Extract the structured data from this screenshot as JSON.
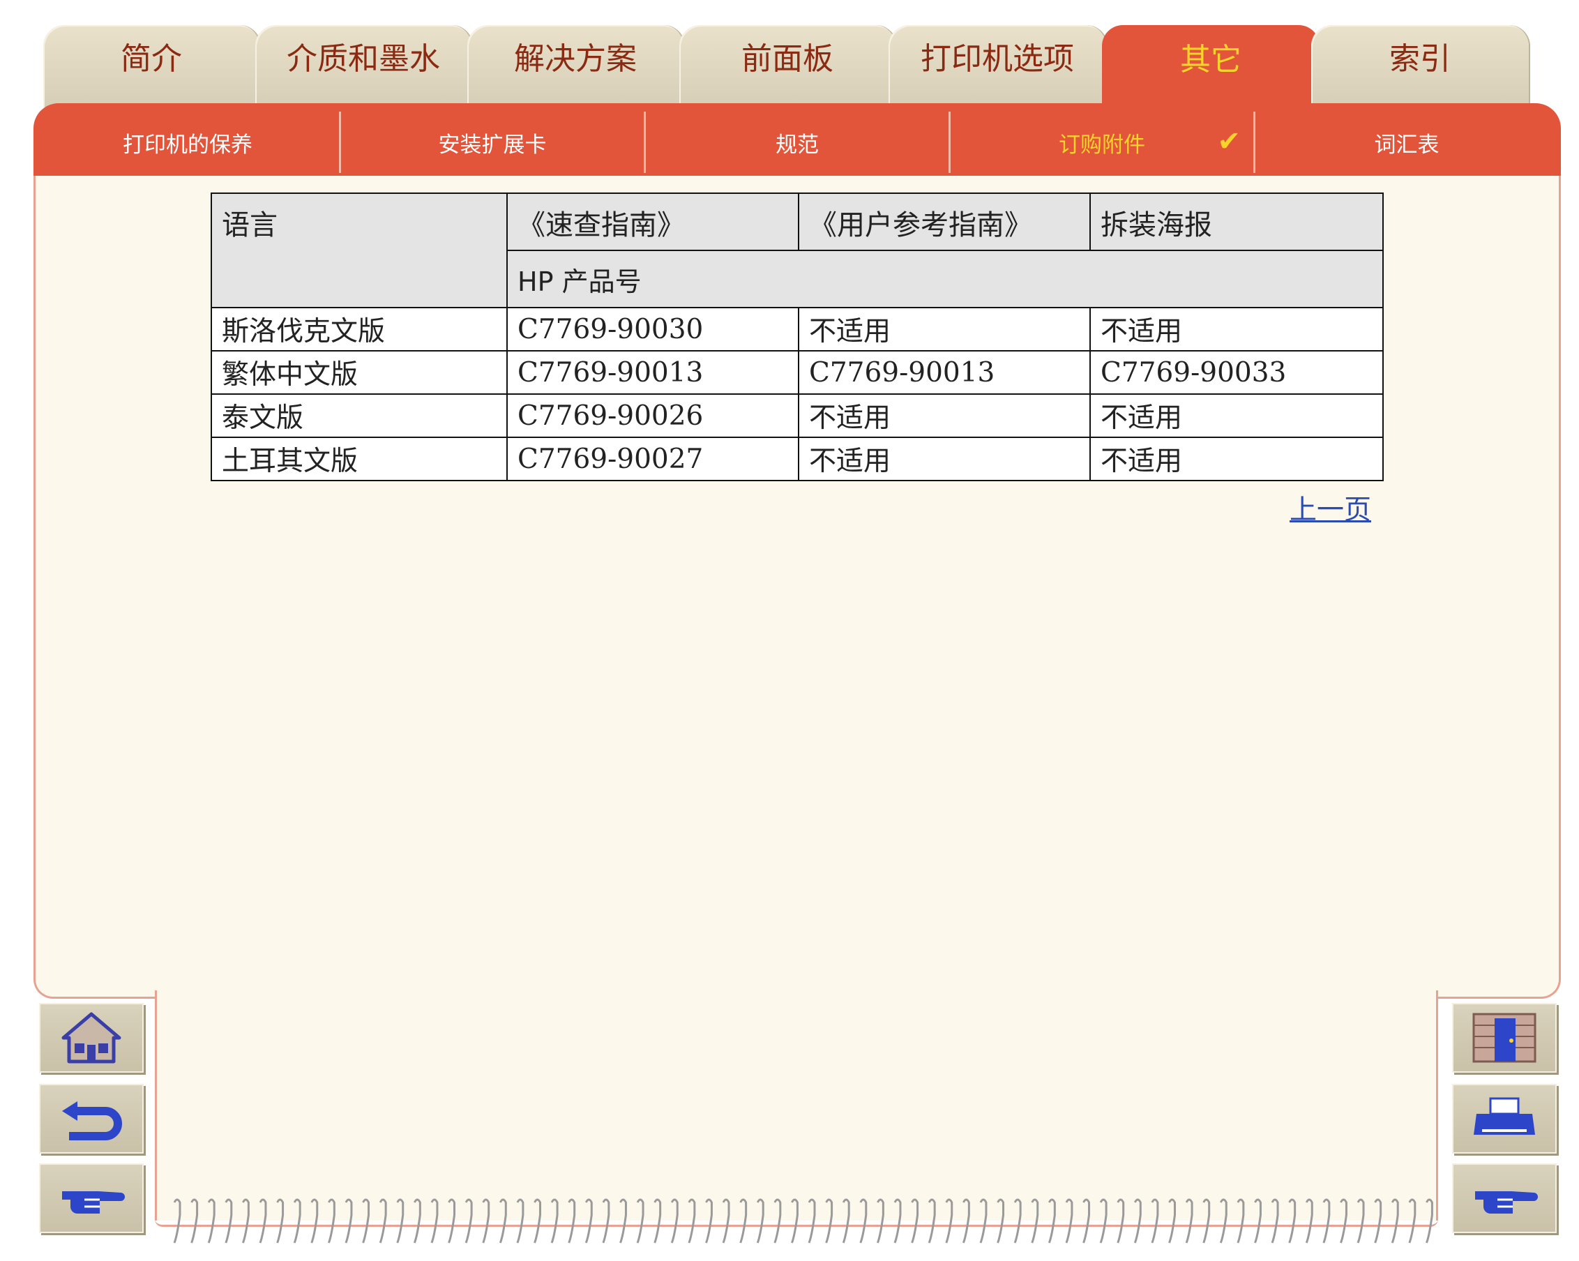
{
  "tabs": [
    {
      "label": "简介"
    },
    {
      "label": "介质和墨水"
    },
    {
      "label": "解决方案"
    },
    {
      "label": "前面板"
    },
    {
      "label": "打印机选项"
    },
    {
      "label": "其它"
    },
    {
      "label": "索引"
    }
  ],
  "subnav": [
    {
      "label": "打印机的保养"
    },
    {
      "label": "安装扩展卡"
    },
    {
      "label": "规范"
    },
    {
      "label": "订购附件",
      "check": "✔"
    },
    {
      "label": "词汇表"
    }
  ],
  "table": {
    "headers": [
      "语言",
      "《速查指南》",
      "《用户参考指南》",
      "拆装海报"
    ],
    "subheader": "HP 产品号",
    "rows": [
      [
        "斯洛伐克文版",
        "C7769-90030",
        "不适用",
        "不适用"
      ],
      [
        "繁体中文版",
        "C7769-90013",
        "C7769-90013",
        "C7769-90033"
      ],
      [
        "泰文版",
        "C7769-90026",
        "不适用",
        "不适用"
      ],
      [
        "土耳其文版",
        "C7769-90027",
        "不适用",
        "不适用"
      ]
    ]
  },
  "prev_link": "上一页",
  "colors": {
    "accent_red": "#e2553a",
    "active_yellow": "#f7d42a",
    "tab_beige": "#d6ceb6",
    "panel_cream": "#fdf8ec",
    "link_blue": "#2b4bb0"
  }
}
